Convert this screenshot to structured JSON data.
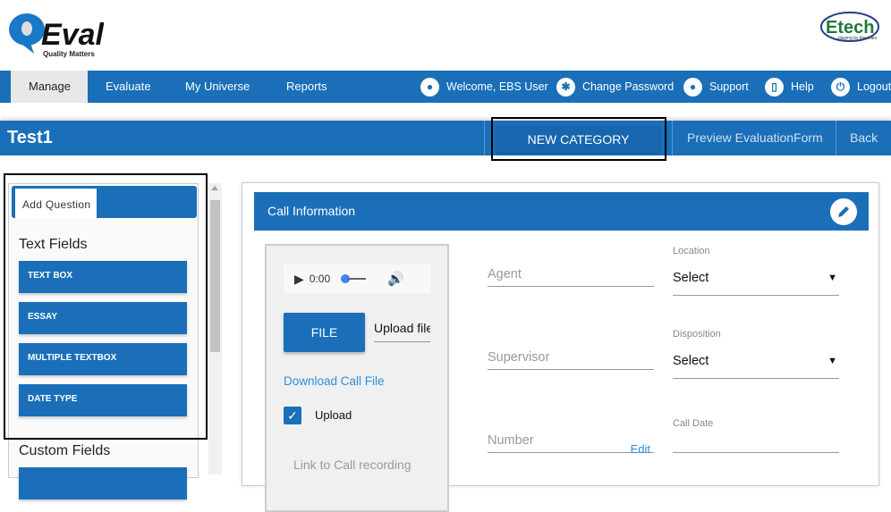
{
  "brand": {
    "logo_text": "Q:Eval",
    "tagline": "Quality Matters",
    "partner_logo": "Etech",
    "partner_tagline": "playing by the rules",
    "accent": "#1a6fb8"
  },
  "nav": {
    "tabs": [
      {
        "label": "Manage",
        "active": true
      },
      {
        "label": "Evaluate"
      },
      {
        "label": "My Universe"
      },
      {
        "label": "Reports"
      }
    ],
    "utilities": [
      {
        "label": "Welcome, EBS User",
        "icon": "user-icon"
      },
      {
        "label": "Change Password",
        "icon": "gear-icon"
      },
      {
        "label": "Support",
        "icon": "support-icon"
      },
      {
        "label": "Help",
        "icon": "book-icon"
      },
      {
        "label": "Logout",
        "icon": "power-icon"
      }
    ]
  },
  "titlebar": {
    "title": "Test1",
    "new_category": "NEW CATEGORY",
    "preview": "Preview EvaluationForm",
    "back": "Back"
  },
  "left": {
    "tab": "Add Question",
    "text_fields_heading": "Text Fields",
    "text_fields": [
      "TEXT BOX",
      "ESSAY",
      "MULTIPLE TEXTBOX",
      "DATE TYPE"
    ],
    "custom_fields_heading": "Custom Fields"
  },
  "card": {
    "title": "Call Information",
    "audio": {
      "time": "0:00"
    },
    "file_button": "FILE",
    "upload_placeholder": "Upload file",
    "download_link": "Download Call File",
    "upload_checkbox": {
      "label": "Upload",
      "checked": true
    },
    "link_recording": "Link to Call recording",
    "agent": "Agent",
    "supervisor": "Supervisor",
    "number": "Number",
    "number_edit": "Edit",
    "location": {
      "label": "Location",
      "value": "Select"
    },
    "disposition": {
      "label": "Disposition",
      "value": "Select"
    },
    "call_date": {
      "label": "Call Date",
      "value": ""
    }
  }
}
